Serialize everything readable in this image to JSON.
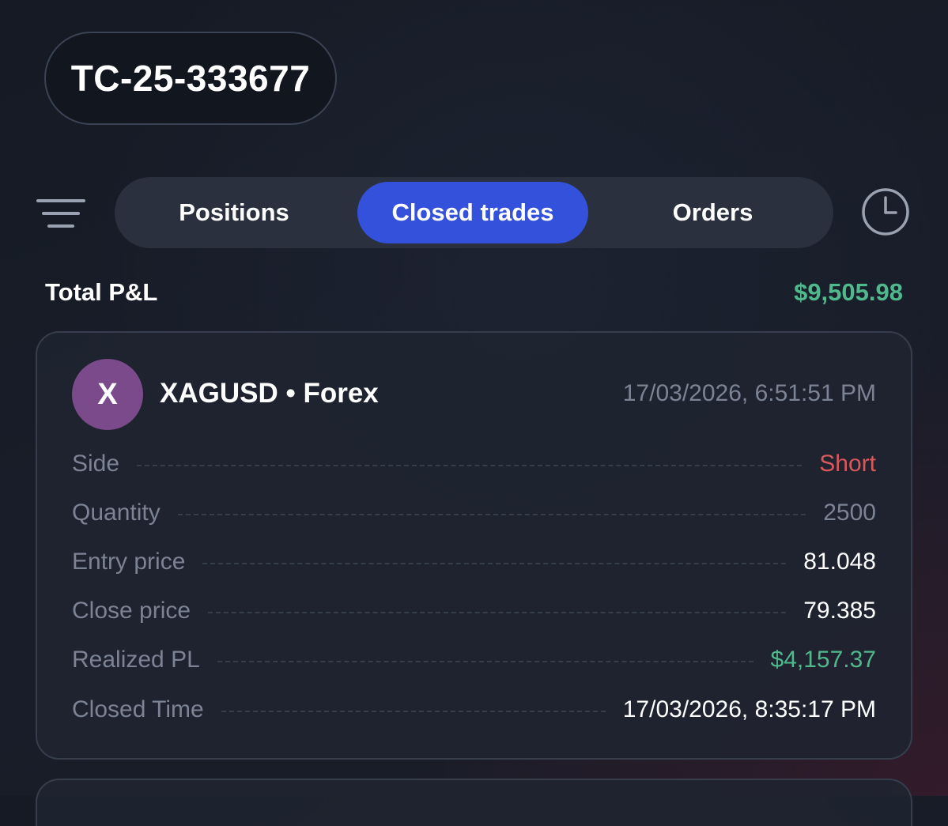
{
  "account": {
    "id": "TC-25-333677"
  },
  "tabs": [
    {
      "label": "Positions",
      "active": false
    },
    {
      "label": "Closed trades",
      "active": true
    },
    {
      "label": "Orders",
      "active": false
    }
  ],
  "icons": {
    "menu": "menu-lines-icon",
    "history": "clock-icon"
  },
  "summary": {
    "total_label": "Total P&L",
    "total_value": "$9,505.98"
  },
  "trade": {
    "avatar_letter": "X",
    "symbol": "XAGUSD • Forex",
    "open_time": "17/03/2026, 6:51:51 PM",
    "rows": [
      {
        "label": "Side",
        "value": "Short"
      },
      {
        "label": "Quantity",
        "value": "2500"
      },
      {
        "label": "Entry price",
        "value": "81.048"
      },
      {
        "label": "Close price",
        "value": "79.385"
      },
      {
        "label": "Realized PL",
        "value": "$4,157.37"
      },
      {
        "label": "Closed Time",
        "value": "17/03/2026, 8:35:17 PM"
      }
    ]
  },
  "colors": {
    "accent": "#3451dc",
    "profit": "#4fb88c",
    "short": "#d9585b",
    "avatar": "#7a4a8b",
    "muted": "#7c8394"
  }
}
